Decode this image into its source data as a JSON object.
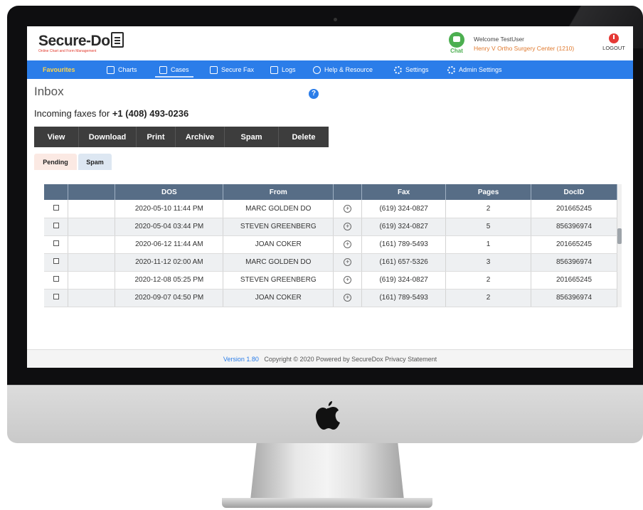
{
  "header": {
    "logo_text_main": "Secure-Do",
    "logo_text_accent": "",
    "logo_subtitle": "Online Chart and Form Management",
    "chat_label": "Chat",
    "welcome_text": "Welcome TestUser",
    "center_name": "Henry V Ortho Surgery Center (1210)",
    "logout_label": "LOGOUT"
  },
  "nav": {
    "items": [
      {
        "label": "Favourites",
        "icon": "star-icon"
      },
      {
        "label": "Charts",
        "icon": "chart-document-icon"
      },
      {
        "label": "Cases",
        "icon": "cases-icon"
      },
      {
        "label": "Secure Fax",
        "icon": "fax-icon"
      },
      {
        "label": "Logs",
        "icon": "logs-icon"
      },
      {
        "label": "Help & Resource",
        "icon": "info-icon"
      },
      {
        "label": "Settings",
        "icon": "gear-icon"
      },
      {
        "label": "Admin Settings",
        "icon": "admin-gear-icon"
      }
    ],
    "active": "Cases"
  },
  "page": {
    "title": "Inbox",
    "incoming_prefix": "Incoming faxes for",
    "incoming_number": "+1 (408) 493-0236"
  },
  "actions": [
    "View",
    "Download",
    "Print",
    "Archive",
    "Spam",
    "Delete"
  ],
  "tabs": [
    "Pending",
    "Spam"
  ],
  "table": {
    "columns": [
      "",
      "",
      "DOS",
      "From",
      "",
      "Fax",
      "Pages",
      "DocID"
    ],
    "rows": [
      {
        "dos": "2020-05-10 11:44 PM",
        "from": "MARC GOLDEN DO",
        "fax": "(619) 324-0827",
        "pages": "2",
        "docid": "201665245"
      },
      {
        "dos": "2020-05-04 03:44 PM",
        "from": "STEVEN GREENBERG",
        "fax": "(619) 324-0827",
        "pages": "5",
        "docid": "856396974"
      },
      {
        "dos": "2020-06-12 11:44 AM",
        "from": "JOAN COKER",
        "fax": "(161) 789-5493",
        "pages": "1",
        "docid": "201665245"
      },
      {
        "dos": "2020-11-12 02:00 AM",
        "from": "MARC GOLDEN DO",
        "fax": "(161) 657-5326",
        "pages": "3",
        "docid": "856396974"
      },
      {
        "dos": "2020-12-08 05:25 PM",
        "from": "STEVEN GREENBERG",
        "fax": "(619) 324-0827",
        "pages": "2",
        "docid": "201665245"
      },
      {
        "dos": "2020-09-07 04:50 PM",
        "from": "JOAN COKER",
        "fax": "(161) 789-5493",
        "pages": "2",
        "docid": "856396974"
      }
    ]
  },
  "footer": {
    "version": "Version 1.80",
    "copyright": "Copyright © 2020 Powered by SecureDox Privacy Statement"
  },
  "colors": {
    "nav_bg": "#2b7de9",
    "table_header": "#576d86",
    "action_bar": "#3d3d3d"
  }
}
